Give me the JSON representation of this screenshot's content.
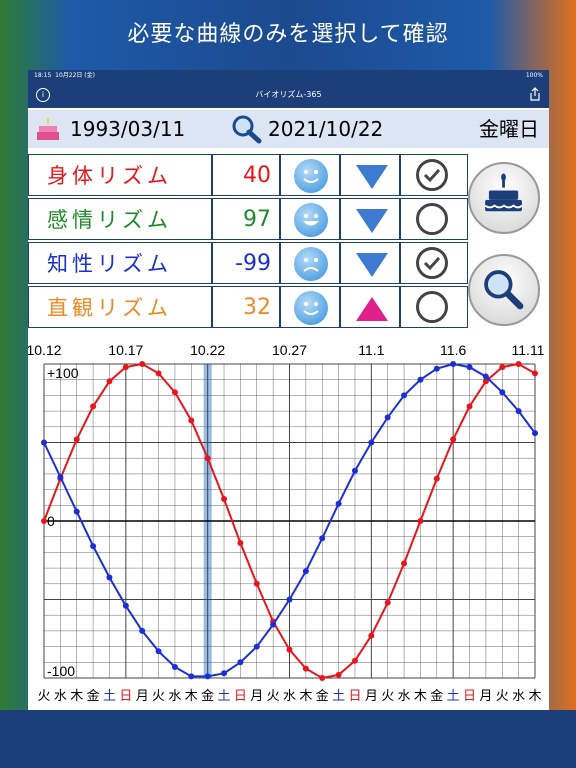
{
  "headline": "必要な曲線のみを選択して確認",
  "status": {
    "time": "18:15",
    "date": "10月22日 (金)",
    "battery": "100%"
  },
  "nav": {
    "title": "バイオリズム-365",
    "info_icon": "info-icon",
    "share_icon": "share-icon"
  },
  "dates": {
    "birth": "1993/03/11",
    "target": "2021/10/22",
    "weekday": "金曜日"
  },
  "rhythms": [
    {
      "name": "身体リズム",
      "value": "40",
      "color": "#e8161b",
      "face": "smile",
      "trend": "down",
      "checked": true
    },
    {
      "name": "感情リズム",
      "value": "97",
      "color": "#1e8a2b",
      "face": "grin",
      "trend": "down",
      "checked": false
    },
    {
      "name": "知性リズム",
      "value": "-99",
      "color": "#1c2fd6",
      "face": "sad",
      "trend": "down",
      "checked": true
    },
    {
      "name": "直観リズム",
      "value": "32",
      "color": "#ef8a22",
      "face": "smile",
      "trend": "up",
      "checked": false
    }
  ],
  "colors": {
    "trend_down": "#3d7ad1",
    "trend_up": "#e01f8c",
    "grid": "#444444",
    "highlight": "#6aa0dd"
  },
  "chart_data": {
    "type": "line",
    "top_labels": [
      "10.12",
      "10.17",
      "10.22",
      "10.27",
      "11.1",
      "11.6",
      "11.11"
    ],
    "y_labels": [
      "+100",
      "0",
      "-100"
    ],
    "ylim": [
      -100,
      100
    ],
    "highlight_day": 10,
    "weekdays": [
      "火",
      "水",
      "木",
      "金",
      "土",
      "日",
      "月",
      "火",
      "水",
      "木",
      "金",
      "土",
      "日",
      "月",
      "火",
      "水",
      "木",
      "金",
      "土",
      "日",
      "月",
      "火",
      "水",
      "木",
      "金",
      "土",
      "日",
      "月",
      "火",
      "水",
      "木"
    ],
    "weekday_colors": [
      "#000",
      "#000",
      "#000",
      "#000",
      "#1c2fd6",
      "#e8161b",
      "#000",
      "#000",
      "#000",
      "#000",
      "#000",
      "#1c2fd6",
      "#e8161b",
      "#000",
      "#000",
      "#000",
      "#000",
      "#000",
      "#1c2fd6",
      "#e8161b",
      "#000",
      "#000",
      "#000",
      "#000",
      "#000",
      "#1c2fd6",
      "#e8161b",
      "#000",
      "#000",
      "#000",
      "#000"
    ],
    "series": [
      {
        "color": "#e8161b",
        "values": [
          0,
          27,
          52,
          73,
          89,
          98,
          100,
          94,
          82,
          64,
          40,
          14,
          -14,
          -40,
          -64,
          -82,
          -94,
          -100,
          -98,
          -89,
          -73,
          -52,
          -27,
          0,
          27,
          52,
          73,
          89,
          98,
          100,
          94
        ]
      },
      {
        "color": "#1c2fd6",
        "values": [
          50,
          28,
          6,
          -16,
          -36,
          -54,
          -70,
          -83,
          -93,
          -99,
          -99,
          -97,
          -90,
          -80,
          -66,
          -50,
          -32,
          -11,
          11,
          32,
          50,
          66,
          80,
          90,
          97,
          100,
          98,
          92,
          82,
          70,
          56
        ]
      }
    ]
  }
}
